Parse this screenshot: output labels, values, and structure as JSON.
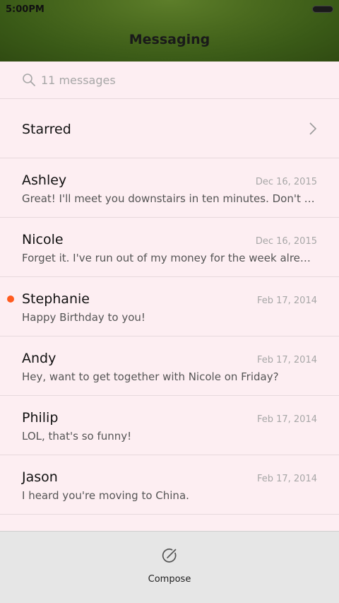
{
  "status_bar": {
    "time": "5:00PM"
  },
  "header": {
    "title": "Messaging"
  },
  "search": {
    "text": "11 messages",
    "icon": "search-icon"
  },
  "starred": {
    "label": "Starred",
    "icon": "chevron-right-icon"
  },
  "messages": [
    {
      "name": "Ashley",
      "date": "Dec 16, 2015",
      "preview": "Great! I'll meet you downstairs in ten minutes. Don't forget your umbrella.",
      "unread": false
    },
    {
      "name": "Nicole",
      "date": "Dec 16, 2015",
      "preview": "Forget it. I've run out of my money for the week already.",
      "unread": false
    },
    {
      "name": "Stephanie",
      "date": "Feb 17, 2014",
      "preview": "Happy Birthday to you!",
      "unread": true
    },
    {
      "name": "Andy",
      "date": "Feb 17, 2014",
      "preview": "Hey, want to get together with Nicole on Friday?",
      "unread": false
    },
    {
      "name": "Philip",
      "date": "Feb 17, 2014",
      "preview": "LOL, that's so funny!",
      "unread": false
    },
    {
      "name": "Jason",
      "date": "Feb 17, 2014",
      "preview": "I heard you're moving to China.",
      "unread": false
    }
  ],
  "bottom_bar": {
    "compose_label": "Compose",
    "icon": "compose-icon"
  },
  "colors": {
    "unread_dot": "#ff5b1f",
    "list_bg": "#fdeef2"
  }
}
